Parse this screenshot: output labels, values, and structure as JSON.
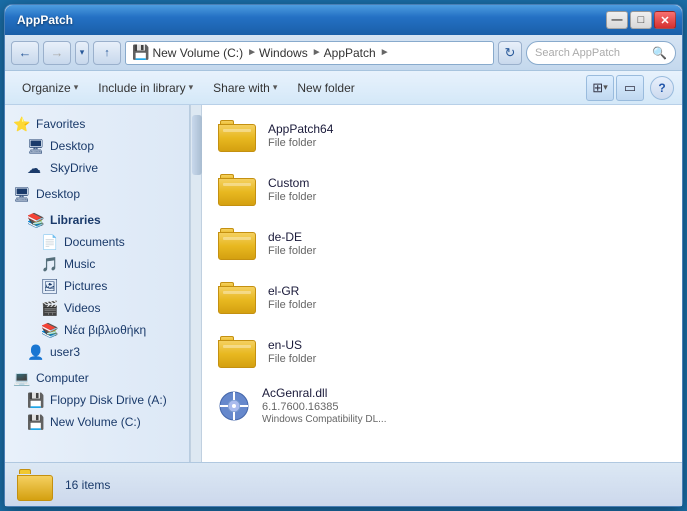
{
  "window": {
    "title": "AppPatch",
    "controls": {
      "minimize": "—",
      "maximize": "□",
      "close": "✕"
    }
  },
  "addressbar": {
    "back_tooltip": "Back",
    "forward_tooltip": "Forward",
    "breadcrumb": [
      {
        "label": "New Volume (C:)",
        "icon": "💾"
      },
      {
        "label": "Windows"
      },
      {
        "label": "AppPatch"
      }
    ],
    "search_placeholder": "Search AppPatch",
    "search_icon": "🔍",
    "refresh_icon": "↻"
  },
  "toolbar": {
    "organize_label": "Organize",
    "include_in_library_label": "Include in library",
    "share_with_label": "Share with",
    "new_folder_label": "New folder",
    "view_icon": "⊞",
    "preview_icon": "▭",
    "help_label": "?"
  },
  "sidebar": {
    "items": [
      {
        "id": "favorites",
        "label": "Favorites",
        "icon": "⭐",
        "indent": 0,
        "is_header": true
      },
      {
        "id": "desktop",
        "label": "Desktop",
        "icon": "🖥",
        "indent": 1
      },
      {
        "id": "skydrive",
        "label": "SkyDrive",
        "icon": "☁",
        "indent": 1
      },
      {
        "id": "desktop2",
        "label": "Desktop",
        "icon": "🖥",
        "indent": 0,
        "is_header": true
      },
      {
        "id": "libraries",
        "label": "Libraries",
        "icon": "📚",
        "indent": 1,
        "is_header": true
      },
      {
        "id": "documents",
        "label": "Documents",
        "icon": "📄",
        "indent": 2
      },
      {
        "id": "music",
        "label": "Music",
        "icon": "🎵",
        "indent": 2
      },
      {
        "id": "pictures",
        "label": "Pictures",
        "icon": "🖼",
        "indent": 2
      },
      {
        "id": "videos",
        "label": "Videos",
        "icon": "🎬",
        "indent": 2
      },
      {
        "id": "new-library",
        "label": "Νέα βιβλιοθήκη",
        "icon": "📚",
        "indent": 2
      },
      {
        "id": "user3",
        "label": "user3",
        "icon": "👤",
        "indent": 1
      },
      {
        "id": "computer",
        "label": "Computer",
        "icon": "💻",
        "indent": 0,
        "is_header": true
      },
      {
        "id": "floppy",
        "label": "Floppy Disk Drive (A:)",
        "icon": "💾",
        "indent": 1
      },
      {
        "id": "newvolume",
        "label": "New Volume (C:)",
        "icon": "💾",
        "indent": 1
      }
    ]
  },
  "files": [
    {
      "name": "AppPatch64",
      "type": "File folder",
      "kind": "folder"
    },
    {
      "name": "Custom",
      "type": "File folder",
      "kind": "folder"
    },
    {
      "name": "de-DE",
      "type": "File folder",
      "kind": "folder"
    },
    {
      "name": "el-GR",
      "type": "File folder",
      "kind": "folder"
    },
    {
      "name": "en-US",
      "type": "File folder",
      "kind": "folder"
    },
    {
      "name": "AcGenral.dll",
      "type": "6.1.7600.16385",
      "subtype": "Windows Compatibility DL...",
      "kind": "dll"
    }
  ],
  "statusbar": {
    "count_text": "16 items"
  }
}
